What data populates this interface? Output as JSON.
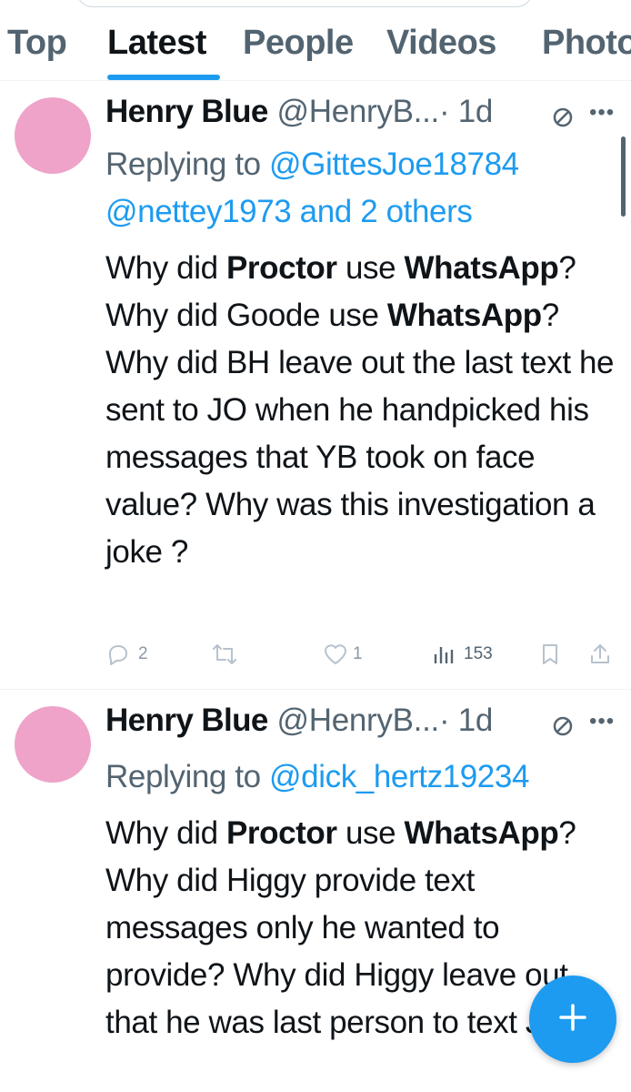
{
  "tabs": [
    {
      "label": "Top"
    },
    {
      "label": "Latest",
      "active": true
    },
    {
      "label": "People"
    },
    {
      "label": "Videos"
    },
    {
      "label": "Photos"
    }
  ],
  "tweets": [
    {
      "author": {
        "name": "Henry Blue",
        "handle": "@HenryB...",
        "time": "· 1d"
      },
      "reply_label": "Replying to",
      "reply_mentions": [
        "@GittesJoe18784",
        "@nettey1973",
        "and 2 others"
      ],
      "body_segments": [
        "Why did ",
        "Proctor",
        " use ",
        "WhatsApp",
        "? Why did Goode use ",
        "WhatsApp",
        "? Why did BH leave out the last text he sent to JO when he handpicked his messages that YB took on face value? Why was this investigation a joke ?"
      ],
      "stats": {
        "replies": "2",
        "retweets": "",
        "likes": "1",
        "views": "153"
      }
    },
    {
      "author": {
        "name": "Henry Blue",
        "handle": "@HenryB...",
        "time": "· 1d"
      },
      "reply_label": "Replying to",
      "reply_mentions": [
        "@dick_hertz19234"
      ],
      "body_segments": [
        "Why did ",
        "Proctor",
        " use ",
        "WhatsApp",
        "? Why did Higgy provide text messages only he wanted to provide? Why did Higgy leave out that he was last person to text JO ?"
      ]
    }
  ],
  "icons": {
    "reply": "reply-bubble-icon",
    "retweet": "retweet-icon",
    "like": "heart-icon",
    "views": "views-bar-chart-icon",
    "bookmark": "bookmark-icon",
    "share": "share-icon",
    "compose": "plus-icon",
    "circle": "circle-slash-icon",
    "more": "more-dots-icon"
  },
  "colors": {
    "accent": "#1d9bf0",
    "text": "#0f1419",
    "muted": "#536471",
    "avatar": "#efa3c9"
  }
}
